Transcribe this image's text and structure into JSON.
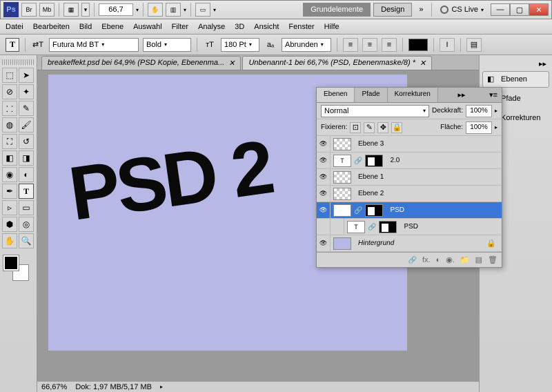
{
  "titlebar": {
    "zoom": "66,7",
    "workspace_active": "Grundelemente",
    "workspace_other": "Design",
    "cslive": "CS Live",
    "br": "Br",
    "mb": "Mb"
  },
  "menu": [
    "Datei",
    "Bearbeiten",
    "Bild",
    "Ebene",
    "Auswahl",
    "Filter",
    "Analyse",
    "3D",
    "Ansicht",
    "Fenster",
    "Hilfe"
  ],
  "options": {
    "font": "Futura Md BT",
    "weight": "Bold",
    "size": "180 Pt",
    "aa": "Abrunden"
  },
  "tabs": [
    {
      "label": "breakeffekt.psd bei 64,9% (PSD Kopie, Ebenenma...",
      "active": false
    },
    {
      "label": "Unbenannt-1 bei 66,7% (PSD, Ebenenmaske/8) *",
      "active": true
    }
  ],
  "status": {
    "zoom": "66,67%",
    "doc": "Dok: 1,97 MB/5,17 MB"
  },
  "canvas_text": "PSD 2",
  "panel": {
    "tabs": [
      "Ebenen",
      "Pfade",
      "Korrekturen"
    ],
    "blend": "Normal",
    "opacity_label": "Deckkraft:",
    "opacity": "100%",
    "lock_label": "Fixieren:",
    "fill_label": "Fläche:",
    "fill": "100%",
    "layers": [
      {
        "name": "Ebene 3",
        "type": "check"
      },
      {
        "name": "2.0",
        "type": "text",
        "mask": true
      },
      {
        "name": "Ebene 1",
        "type": "check"
      },
      {
        "name": "Ebene 2",
        "type": "check"
      },
      {
        "name": "PSD",
        "type": "text",
        "mask": true,
        "selected": true
      },
      {
        "name": "PSD",
        "type": "text",
        "mask": true,
        "noeye": true
      },
      {
        "name": "Hintergrund",
        "type": "bg",
        "italic": true,
        "lock": true
      }
    ]
  },
  "dock": [
    {
      "label": "Ebenen",
      "active": true,
      "icon": "layers"
    },
    {
      "label": "Pfade",
      "active": false,
      "icon": "paths"
    },
    {
      "label": "Korrekturen",
      "active": false,
      "icon": "adjust"
    }
  ]
}
